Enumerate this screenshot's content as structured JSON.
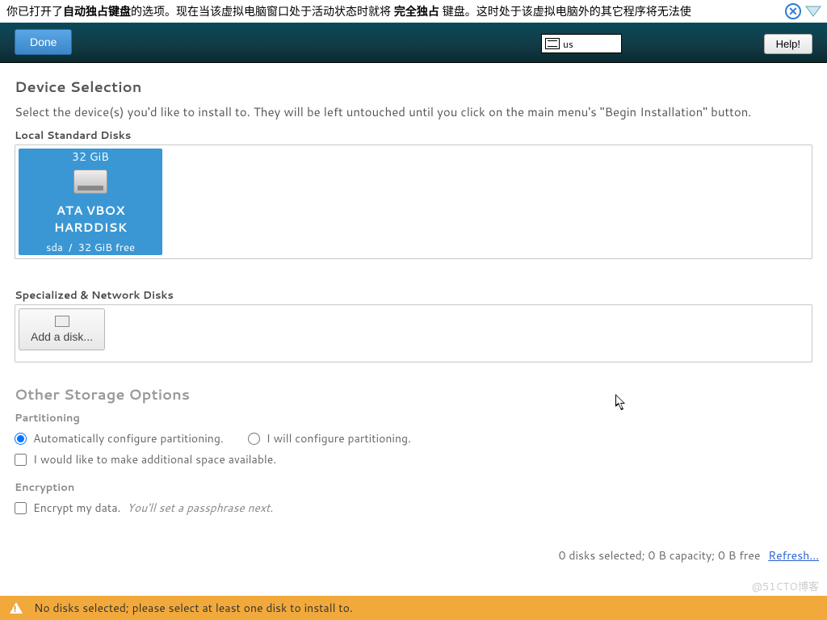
{
  "host_notice": {
    "part1": "你已打开了",
    "bold1": "自动独占键盘",
    "part2": "的选项。现在当该虚拟电脑窗口处于活动状态时就将",
    "bold2": "完全独占",
    "part3": "键盘。这时处于该虚拟电脑外的其它程序将无法使",
    "close_label": "✕"
  },
  "header": {
    "done": "Done",
    "keyboard_layout": "us",
    "help": "Help!"
  },
  "device_selection": {
    "title": "Device Selection",
    "instruction": "Select the device(s) you'd like to install to.  They will be left untouched until you click on the main menu's \"Begin Installation\" button.",
    "local_label": "Local Standard Disks",
    "network_label": "Specialized & Network Disks",
    "add_disk": "Add a disk..."
  },
  "disk": {
    "size": "32 GiB",
    "name": "ATA VBOX HARDDISK",
    "dev": "sda",
    "sep": "/",
    "free": "32 GiB free"
  },
  "other": {
    "title": "Other Storage Options",
    "partitioning_label": "Partitioning",
    "auto": "Automatically configure partitioning.",
    "manual": "I will configure partitioning.",
    "reclaim": "I would like to make additional space available.",
    "encryption_label": "Encryption",
    "encrypt": "Encrypt my data.",
    "encrypt_hint": "You'll set a passphrase next."
  },
  "summary": {
    "text": "0 disks selected; 0 B capacity; 0 B free",
    "refresh": "Refresh..."
  },
  "warning": "No disks selected; please select at least one disk to install to.",
  "watermark": "@51CTO博客"
}
